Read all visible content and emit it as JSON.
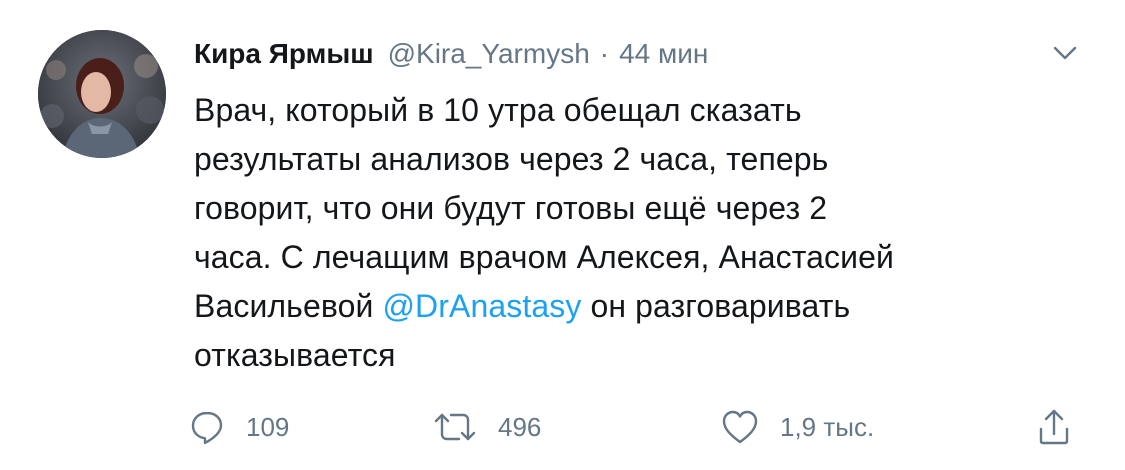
{
  "tweet": {
    "display_name": "Кира Ярмыш",
    "handle": "@Kira_Yarmysh",
    "separator": "·",
    "timestamp": "44 мин",
    "text": {
      "line1": "Врач, который в 10 утра обещал сказать",
      "line2": "результаты анализов через 2 часа, теперь",
      "line3": "говорит, что они будут готовы ещё через 2",
      "line4": "часа. С лечащим врачом Алексея, Анастасией",
      "line5_before": "Васильевой ",
      "line5_mention": "@DrAnastasy",
      "line5_after": " он разговаривать",
      "line6": "отказывается"
    },
    "actions": {
      "reply_count": "109",
      "retweet_count": "496",
      "like_count": "1,9 тыс."
    }
  },
  "colors": {
    "mention": "#1da1f2",
    "secondary_text": "#657786",
    "primary_text": "#14171a",
    "icon": "#657786"
  },
  "icons": {
    "menu": "chevron-down-icon",
    "reply": "reply-icon",
    "retweet": "retweet-icon",
    "like": "heart-icon",
    "share": "share-icon"
  }
}
